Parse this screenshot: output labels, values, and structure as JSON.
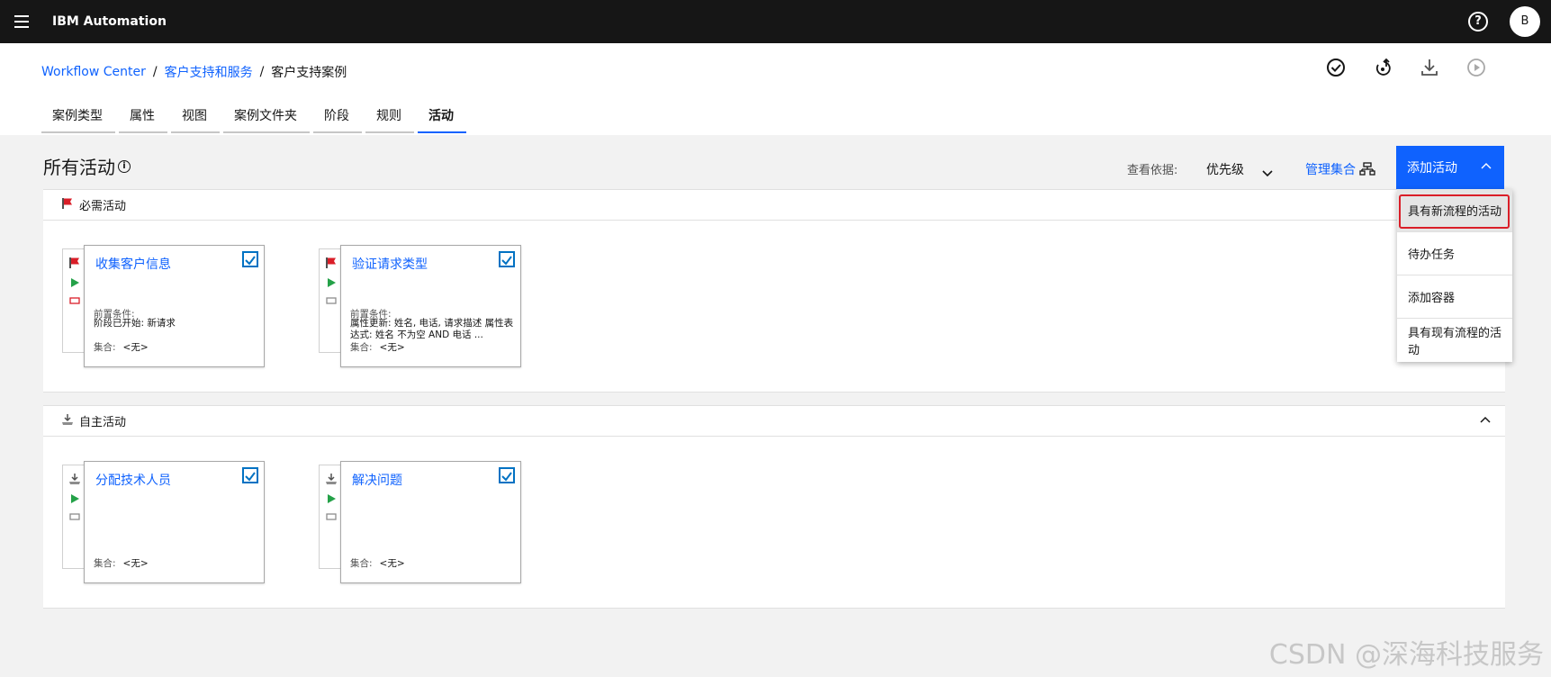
{
  "topbar": {
    "brand": "IBM Automation",
    "help": "?",
    "avatar": "B"
  },
  "breadcrumb": {
    "items": [
      "Workflow Center",
      "客户支持和服务",
      "客户支持案例"
    ],
    "separator": "/"
  },
  "tabs": [
    "案例类型",
    "属性",
    "视图",
    "案例文件夹",
    "阶段",
    "规则",
    "活动"
  ],
  "active_tab": "活动",
  "main": {
    "title": "所有活动",
    "info": "i",
    "view_by_label": "查看依据:",
    "view_by_value": "优先级",
    "manage_label": "管理集合",
    "add_button": "添加活动"
  },
  "menu": [
    "具有新流程的活动",
    "待办任务",
    "添加容器",
    "具有现有流程的活动"
  ],
  "sections": [
    {
      "title": "必需活动",
      "cards": [
        {
          "title": "收集客户信息",
          "pre_label": "前置条件:",
          "pre_value": "阶段已开始: 新请求",
          "coll_label": "集合:",
          "coll_value": "<无>"
        },
        {
          "title": "验证请求类型",
          "pre_label": "前置条件:",
          "pre_value": "属性更新: 姓名, 电话, 请求描述 属性表达式: 姓名 不为空 AND 电话 ...",
          "coll_label": "集合:",
          "coll_value": "<无>"
        }
      ]
    },
    {
      "title": "自主活动",
      "cards": [
        {
          "title": "分配技术人员",
          "pre_label": "",
          "pre_value": "",
          "coll_label": "集合:",
          "coll_value": "<无>"
        },
        {
          "title": "解决问题",
          "pre_label": "",
          "pre_value": "",
          "coll_label": "集合:",
          "coll_value": "<无>"
        }
      ]
    }
  ],
  "watermark": "CSDN @深海科技服务",
  "colors": {
    "accent": "#0f62fe",
    "topbar": "#161616",
    "highlight_border": "#da1e28"
  }
}
